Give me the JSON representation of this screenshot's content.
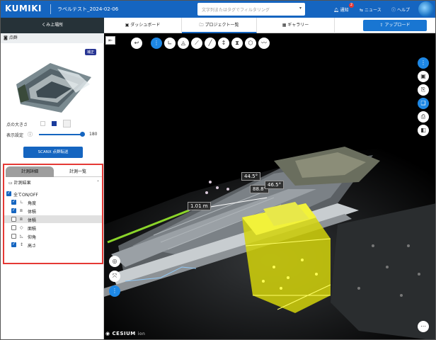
{
  "header": {
    "logo": "KUMIKI",
    "project_title": "ラベルテスト_2024-02-06",
    "search_placeholder": "文字列またはタグでフィルタリング",
    "notifications_label": "通知",
    "notifications_count": "2",
    "news_label": "ニュース",
    "help_label": "ヘルプ"
  },
  "nav": {
    "back_label": "くみ上場所",
    "tabs": [
      {
        "label": "ダッシュボード",
        "icon": "dashboard-icon"
      },
      {
        "label": "プロジェクト一覧",
        "icon": "folder-icon"
      },
      {
        "label": "ギャラリー",
        "icon": "gallery-icon"
      }
    ],
    "upload_label": "アップロード"
  },
  "sidebar": {
    "pointcloud_header": "点群",
    "preview_badge": "補正",
    "point_size_label": "点の大きさ",
    "display_setting_label": "表示設定",
    "display_value": "180",
    "transfer_button": "SCANX 点群転送",
    "measure_tabs": [
      "計測詳細",
      "計測一覧"
    ],
    "result_header": "計測結果",
    "all_toggle": "全てON/OFF",
    "items": [
      {
        "label": "角度",
        "checked": true
      },
      {
        "label": "体積",
        "checked": true
      },
      {
        "label": "体積",
        "checked": false
      },
      {
        "label": "面積",
        "checked": false
      },
      {
        "label": "仰角",
        "checked": false
      },
      {
        "label": "高さ",
        "checked": true
      }
    ]
  },
  "viewer": {
    "labels": [
      "44.5°",
      "88.8°",
      "46.5°",
      "1.01 m"
    ],
    "credit": "CESIUM",
    "credit_suffix": "ion"
  },
  "colors": {
    "brand": "#1565c0",
    "highlight": "#e53935",
    "selection": "#e8e800"
  }
}
